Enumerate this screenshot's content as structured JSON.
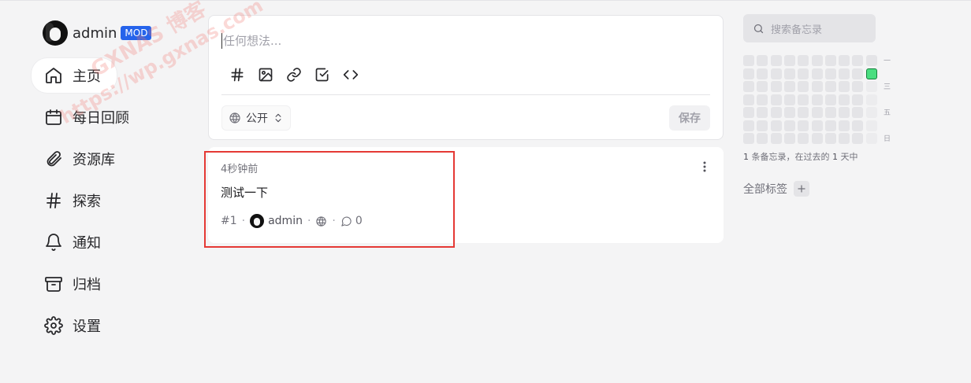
{
  "user": {
    "name": "admin",
    "role_badge": "MOD"
  },
  "nav": {
    "items": [
      {
        "label": "主页",
        "icon": "home-icon",
        "active": true
      },
      {
        "label": "每日回顾",
        "icon": "calendar-icon"
      },
      {
        "label": "资源库",
        "icon": "paperclip-icon"
      },
      {
        "label": "探索",
        "icon": "hash-icon"
      },
      {
        "label": "通知",
        "icon": "bell-icon"
      },
      {
        "label": "归档",
        "icon": "archive-icon"
      },
      {
        "label": "设置",
        "icon": "gear-icon"
      }
    ]
  },
  "editor": {
    "placeholder": "任何想法...",
    "tools": [
      "hash-icon",
      "image-icon",
      "link-icon",
      "checkbox-icon",
      "code-icon"
    ],
    "visibility": "公开",
    "save_label": "保存"
  },
  "memo": {
    "time": "4秒钟前",
    "content": "测试一下",
    "id": "#1",
    "author": "admin",
    "comment_count": "0"
  },
  "sidebar_right": {
    "search_placeholder": "搜索备忘录",
    "weekdays": [
      "一",
      "三",
      "五",
      "日"
    ],
    "stats": {
      "count": "1",
      "mid": " 条备忘录，在过去的 ",
      "days": "1",
      "suffix": " 天中"
    },
    "tags_label": "全部标签"
  },
  "watermark": {
    "line1": "GXNAS 博客",
    "line2": "https://wp.gxnas.com"
  },
  "colors": {
    "accent_badge": "#2563eb",
    "heat_active": "#4ade80",
    "highlight_border": "#e53935"
  }
}
